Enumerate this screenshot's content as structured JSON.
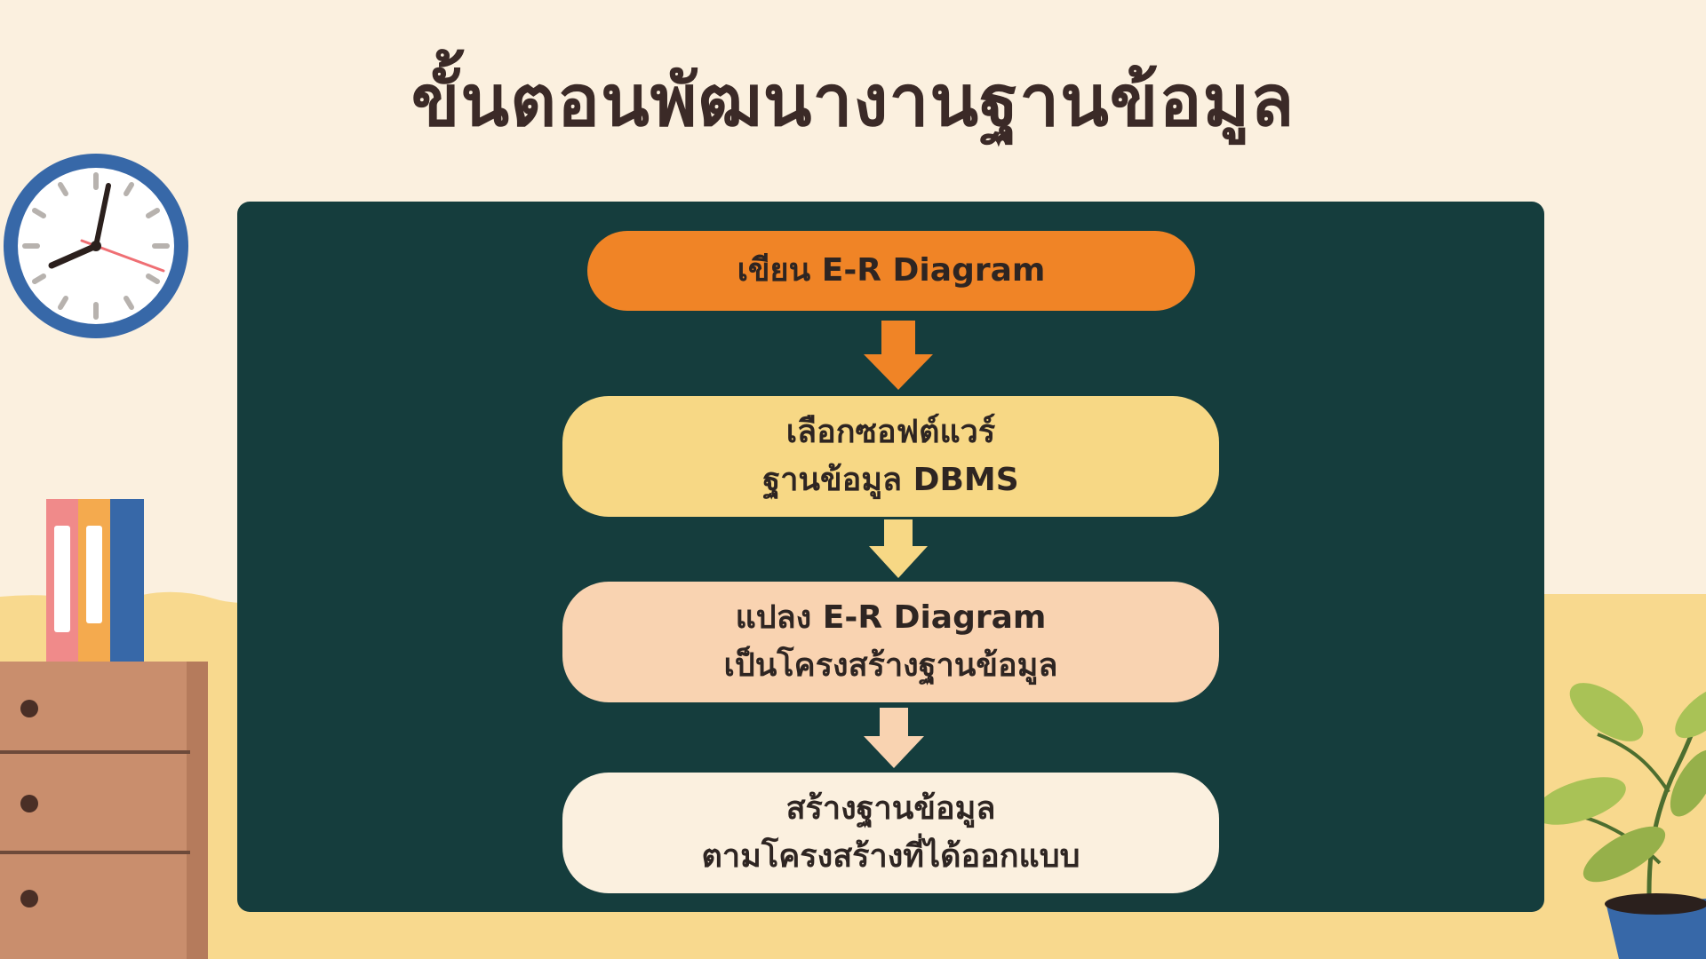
{
  "title": "ขั้นตอนพัฒนางานฐานข้อมูล",
  "steps": [
    {
      "label": "เขียน E-R Diagram",
      "color": "#f08426"
    },
    {
      "label": "เลือกซอฟต์แวร์\nฐานข้อมูล DBMS",
      "color": "#f7d885"
    },
    {
      "label": "แปลง E-R Diagram\nเป็นโครงสร้างฐานข้อมูล",
      "color": "#f9d3b1"
    },
    {
      "label": "สร้างฐานข้อมูล\nตามโครงสร้างที่ได้ออกแบบ",
      "color": "#fbf0df"
    }
  ],
  "colors": {
    "background": "#fbf0df",
    "floor": "#f8d98e",
    "board": "#153d3d",
    "title": "#3b2a27",
    "clock_rim": "#3768a8",
    "cabinet": "#c98e6d"
  },
  "icons": {
    "clock": "wall-clock-icon",
    "books": "binders-icon",
    "cabinet": "drawer-cabinet-icon",
    "plant": "potted-plant-icon"
  }
}
